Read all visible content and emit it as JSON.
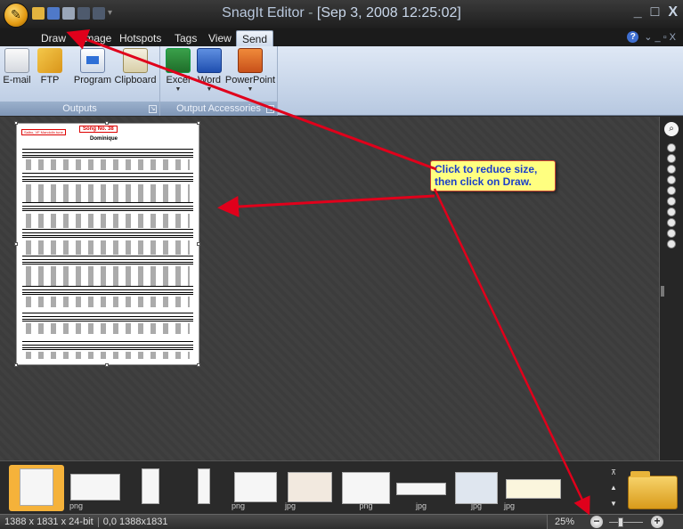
{
  "window": {
    "app_name": "SnagIt Editor",
    "separator": "-",
    "doc_title": "[Sep 3, 2008 12:25:02]",
    "controls": [
      "_",
      "□",
      "X"
    ]
  },
  "quick_access": [
    "open-icon",
    "save-icon",
    "print-icon",
    "undo-icon",
    "redo-icon"
  ],
  "tabs": [
    {
      "label": "Draw"
    },
    {
      "label": "Image"
    },
    {
      "label": "Hotspots"
    },
    {
      "label": "Tags"
    },
    {
      "label": "View"
    },
    {
      "label": "Send",
      "active": true
    }
  ],
  "help": {
    "icon": "?",
    "extra": "⌄ _ ▫ X"
  },
  "ribbon": {
    "outputs": {
      "label": "Outputs",
      "buttons": [
        {
          "label": "E-mail",
          "icon": "envelope-icon"
        },
        {
          "label": "FTP",
          "icon": "ftp-folder-icon"
        },
        {
          "label": "Program",
          "icon": "program-icon"
        },
        {
          "label": "Clipboard",
          "icon": "clipboard-icon"
        }
      ]
    },
    "accessories": {
      "label": "Output Accessories",
      "buttons": [
        {
          "label": "Excel",
          "icon": "excel-icon"
        },
        {
          "label": "Word",
          "icon": "word-icon"
        },
        {
          "label": "PowerPoint",
          "icon": "powerpoint-icon"
        }
      ]
    }
  },
  "document": {
    "header_left": "Salbo, VF Mandolin tune",
    "song_number": "Song No. 38",
    "song_title": "Dominique"
  },
  "callout": {
    "text": "Click to reduce size, then click on Draw."
  },
  "tray": {
    "thumbnails": [
      {
        "caption": "",
        "selected": true
      },
      {
        "caption": "png"
      },
      {
        "caption": ""
      },
      {
        "caption": ""
      },
      {
        "caption": "png"
      },
      {
        "caption": "jpg"
      },
      {
        "caption": "png"
      },
      {
        "caption": "jpg"
      },
      {
        "caption": "jpg"
      },
      {
        "caption": "jpg"
      }
    ]
  },
  "status": {
    "image_info": "1388 x 1831 x 24-bit",
    "selection_info": "0,0  1388x1831",
    "zoom": "25%"
  },
  "colors": {
    "accent_red": "#e0001b",
    "callout_fill": "#ffff80",
    "callout_text": "#1b3fc9",
    "tray_selected": "#f5b23a"
  }
}
